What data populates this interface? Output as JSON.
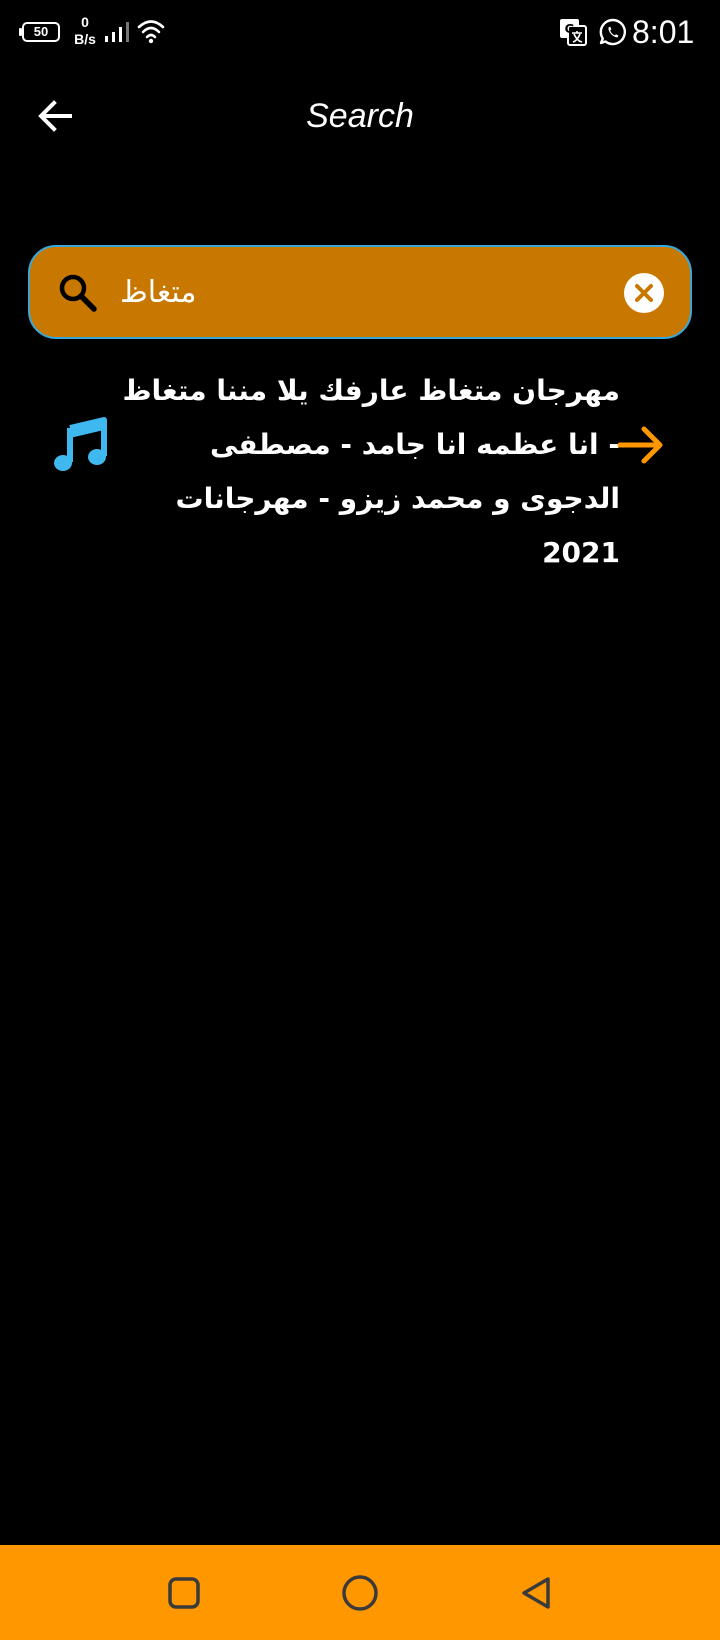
{
  "status_bar": {
    "battery_level": "50",
    "net_speed_value": "0",
    "net_speed_unit": "B/s",
    "time": "8:01",
    "icons": [
      "battery-icon",
      "signal-icon",
      "wifi-icon",
      "translate-icon",
      "whatsapp-icon"
    ]
  },
  "header": {
    "title": "Search",
    "back_icon": "arrow-left-icon"
  },
  "search": {
    "value": "متغاظ",
    "search_icon": "search-icon",
    "clear_icon": "close-icon",
    "background_color": "#c87800",
    "border_color": "#3aa7d8"
  },
  "results": [
    {
      "title": "مهرجان متغاظ عارفك يلا مننا متغاظ - انا عظمه انا جامد - مصطفى الدجوى و محمد زيزو - مهرجانات 2021",
      "leading_icon": "music-note-icon",
      "trailing_icon": "arrow-right-icon",
      "icon_color": "#3fb8f0",
      "arrow_color": "#ff9800"
    }
  ],
  "nav_bar": {
    "background_color": "#ff9800",
    "buttons": [
      "recents-button",
      "home-button",
      "back-button"
    ]
  }
}
